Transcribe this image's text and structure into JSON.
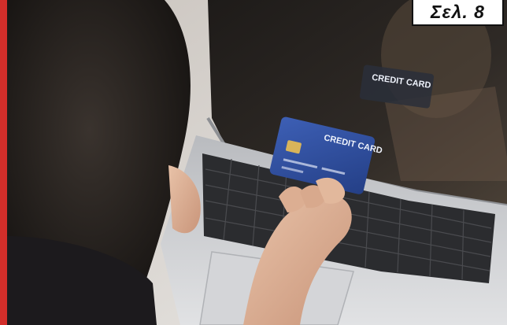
{
  "page_badge": {
    "label": "Σελ. 8"
  },
  "photo": {
    "card_label": "CREDIT CARD",
    "reflection_label": "CREDIT CARD"
  },
  "colors": {
    "accent_bar": "#d22e2a",
    "card_blue": "#2f4ea0",
    "chip_gold": "#d8b45a",
    "laptop_silver": "#c9cbcf",
    "screen_dark": "#262320"
  }
}
